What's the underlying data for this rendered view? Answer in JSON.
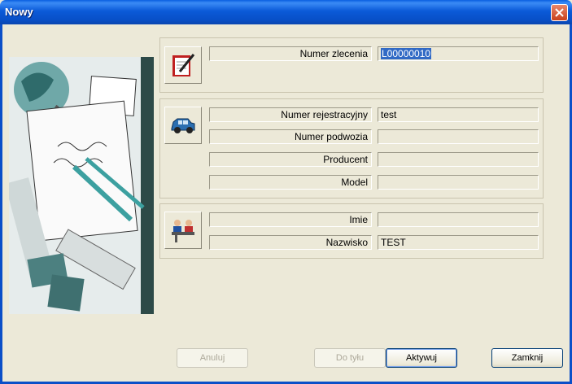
{
  "window": {
    "title": "Nowy",
    "close_icon": "close-icon"
  },
  "order": {
    "icon": "notepad-pencil-icon",
    "number_label": "Numer zlecenia",
    "number_value": "L00000010"
  },
  "vehicle": {
    "icon": "car-icon",
    "registration_label": "Numer rejestracyjny",
    "registration_value": "test",
    "chassis_label": "Numer podwozia",
    "chassis_value": "",
    "manufacturer_label": "Producent",
    "manufacturer_value": "",
    "model_label": "Model",
    "model_value": ""
  },
  "customer": {
    "icon": "people-at-counter-icon",
    "first_name_label": "Imie",
    "first_name_value": "",
    "last_name_label": "Nazwisko",
    "last_name_value": "TEST"
  },
  "buttons": {
    "cancel": "Anuluj",
    "back": "Do tyłu",
    "activate": "Aktywuj",
    "close": "Zamknij"
  }
}
